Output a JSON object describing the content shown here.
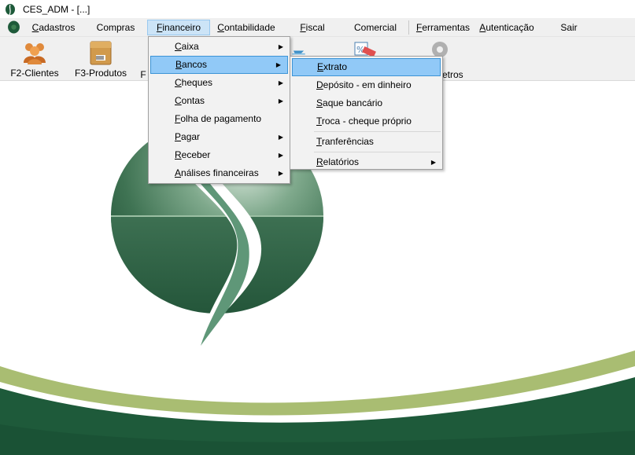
{
  "window": {
    "title": "CES_ADM - [...]"
  },
  "menubar": {
    "items": [
      {
        "label": "Cadastros",
        "mnemonic": "C",
        "rest": "adastros"
      },
      {
        "label": "Compras",
        "mnemonic": "",
        "rest": "Compras"
      },
      {
        "label": "Financeiro",
        "mnemonic": "F",
        "rest": "inanceiro"
      },
      {
        "label": "Contabilidade",
        "mnemonic": "C",
        "rest": "ontabilidade"
      },
      {
        "label": "Fiscal",
        "mnemonic": "F",
        "rest": "iscal"
      },
      {
        "label": "Comercial",
        "mnemonic": "",
        "rest": "Comercial"
      },
      {
        "label": "Ferramentas",
        "mnemonic": "F",
        "rest": "erramentas"
      },
      {
        "label": "Autenticação",
        "mnemonic": "A",
        "rest": "utenticação"
      },
      {
        "label": "Sair",
        "mnemonic": "",
        "rest": "Sair"
      }
    ]
  },
  "toolbar": {
    "buttons": [
      {
        "label": "F2-Clientes",
        "icon": "clients-icon"
      },
      {
        "label": "F3-Produtos",
        "icon": "products-box-icon"
      },
      {
        "label": "F",
        "icon": "hidden-icon"
      },
      {
        "label": "etros",
        "icon": "gear-icon"
      }
    ]
  },
  "financeiro_menu": {
    "items": [
      {
        "mnemonic": "C",
        "rest": "aixa",
        "submenu": true
      },
      {
        "mnemonic": "B",
        "rest": "ancos",
        "submenu": true
      },
      {
        "mnemonic": "C",
        "rest": "heques",
        "submenu": true
      },
      {
        "mnemonic": "C",
        "rest": "ontas",
        "submenu": true
      },
      {
        "mnemonic": "F",
        "rest": "olha de pagamento",
        "submenu": false
      },
      {
        "mnemonic": "P",
        "rest": "agar",
        "submenu": true
      },
      {
        "mnemonic": "R",
        "rest": "eceber",
        "submenu": true
      },
      {
        "mnemonic": "A",
        "rest": "nálises financeiras",
        "submenu": true
      }
    ]
  },
  "bancos_submenu": {
    "items": [
      {
        "mnemonic": "E",
        "rest": "xtrato",
        "submenu": false
      },
      {
        "mnemonic": "D",
        "rest": "epósito - em dinheiro",
        "submenu": false
      },
      {
        "mnemonic": "S",
        "rest": "aque bancário",
        "submenu": false
      },
      {
        "mnemonic": "T",
        "rest": "roca - cheque próprio",
        "submenu": false
      },
      {
        "mnemonic": "T",
        "rest": "ranferências",
        "submenu": false
      },
      {
        "mnemonic": "R",
        "rest": "elatórios",
        "submenu": true
      }
    ]
  },
  "colors": {
    "dark_green": "#1e5a3a",
    "light_green": "#a9bd72",
    "highlight": "#91c9f7"
  }
}
